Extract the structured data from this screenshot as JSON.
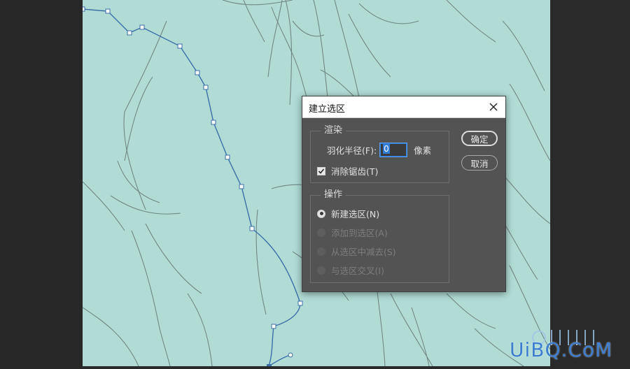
{
  "dialog": {
    "title": "建立选区",
    "render_group": {
      "legend": "渲染",
      "feather_label": "羽化半径(F):",
      "feather_value": "0",
      "feather_unit": "像素",
      "antialias_label": "消除锯齿(T)",
      "antialias_checked": true
    },
    "operation_group": {
      "legend": "操作",
      "options": [
        {
          "label": "新建选区(N)",
          "selected": true,
          "enabled": true
        },
        {
          "label": "添加到选区(A)",
          "selected": false,
          "enabled": false
        },
        {
          "label": "从选区中减去(S)",
          "selected": false,
          "enabled": false
        },
        {
          "label": "与选区交叉(I)",
          "selected": false,
          "enabled": false
        }
      ]
    },
    "ok_label": "确定",
    "cancel_label": "取消"
  },
  "watermark": "UiBQ.CoM",
  "colors": {
    "canvas": "#b1dcd6",
    "dialog_bg": "#535353",
    "path": "#3a6fa8",
    "accent": "#2f7bd6"
  }
}
